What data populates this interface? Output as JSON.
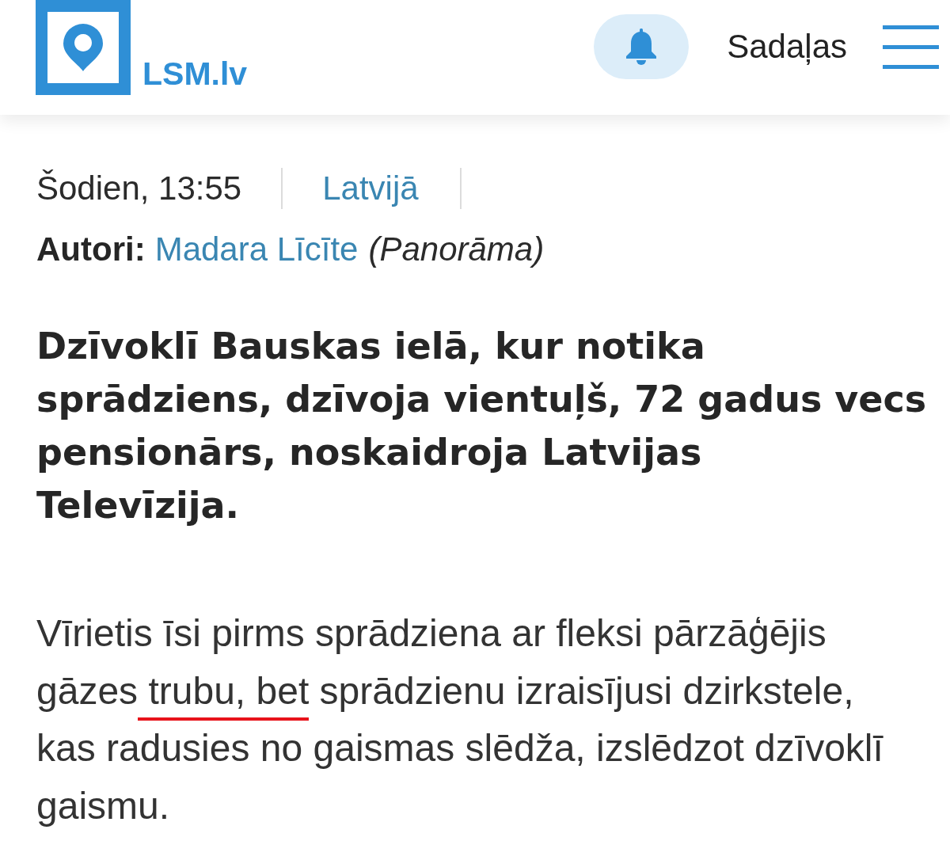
{
  "header": {
    "logo_text": "LSM.lv",
    "sections_label": "Sadaļas"
  },
  "article": {
    "date": "Šodien, 13:55",
    "category": "Latvijā",
    "authors": {
      "label": "Autori:",
      "name": "Madara Līcīte",
      "source": "(Panorāma)"
    },
    "headline": "Dzīvoklī Bauskas ielā, kur notika\nsprādziens, dzīvoja vientuļš, 72 gadus vecs\npensionārs, noskaidroja Latvijas\nTelevīzija.",
    "paragraph": [
      {
        "text": "Vīrietis īsi pirms sprādziena ar fleksi pārzāģējis gāzes",
        "underlined": false
      },
      {
        "text": " trubu, bet",
        "underlined": true
      },
      {
        "text": " sprādzienu izraisījusi dzirkstele, kas radusies no gaismas slēdža, izslēdzot dzīvoklī gaismu.",
        "underlined": false
      }
    ]
  }
}
